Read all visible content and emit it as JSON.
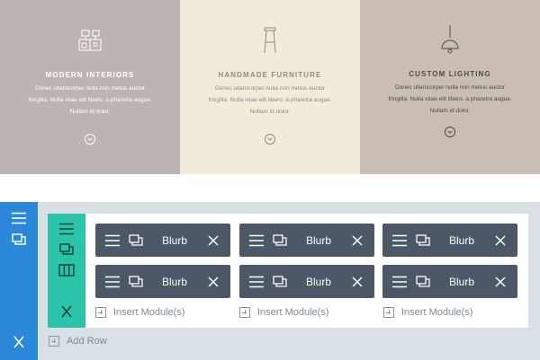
{
  "preview": {
    "columns": [
      {
        "title": "MODERN INTERIORS",
        "body": "Donec ullamcorper nulla non metus auctor fringilla. Nulla vitae elit libero, a pharetra augue. Nullam id dolor.",
        "icon": "kitchen-icon"
      },
      {
        "title": "HANDMADE FURNITURE",
        "body": "Donec ullamcorper nulla non metus auctor fringilla. Nulla vitae elit libero, a pharetra augue. Nullam id dolor.",
        "icon": "stool-icon"
      },
      {
        "title": "CUSTOM LIGHTING",
        "body": "Donec ullamcorper nulla non metus auctor fringilla. Nulla vitae elit libero, a pharetra augue. Nullam id dolor.",
        "icon": "pendant-lamp-icon"
      }
    ]
  },
  "builder": {
    "modules": [
      {
        "label": "Blurb"
      },
      {
        "label": "Blurb"
      },
      {
        "label": "Blurb"
      },
      {
        "label": "Blurb"
      },
      {
        "label": "Blurb"
      },
      {
        "label": "Blurb"
      }
    ],
    "insert_label": "Insert Module(s)",
    "add_row_label": "Add Row"
  },
  "colors": {
    "section_bar": "#2b87da",
    "row_bar": "#29c4a9",
    "module_bg": "#4c5866",
    "builder_bg": "#d9e0e6"
  }
}
